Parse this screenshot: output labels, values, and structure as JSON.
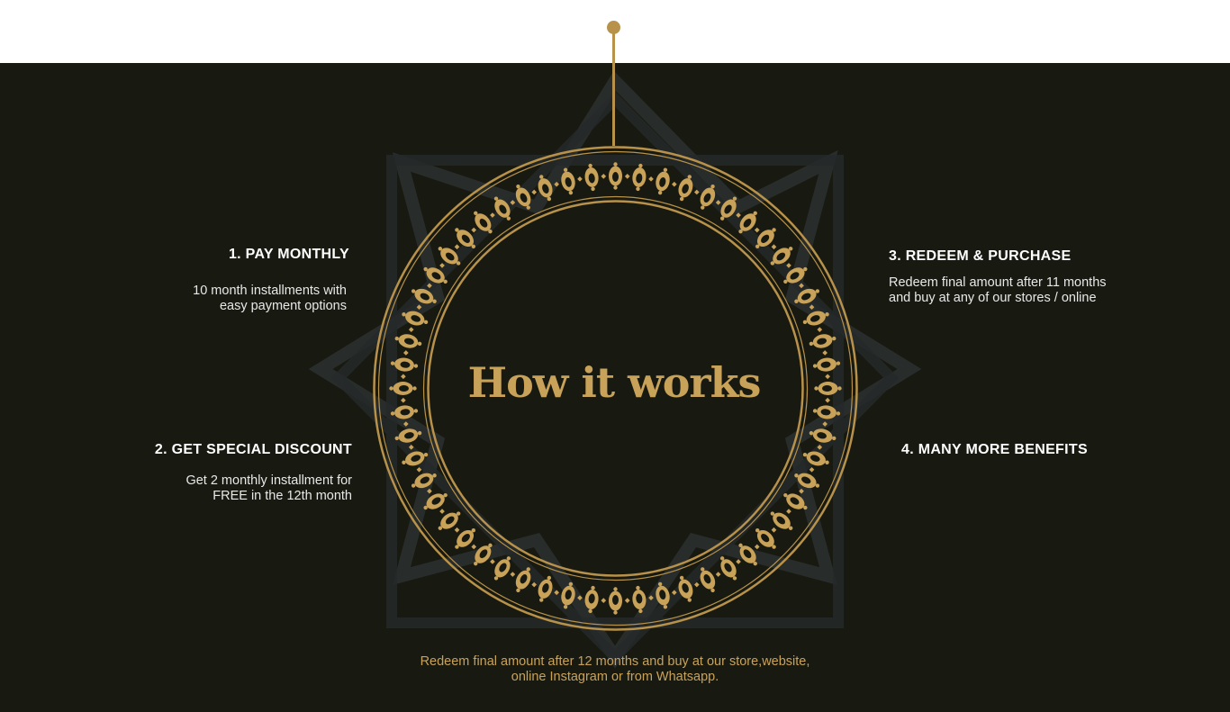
{
  "title": "How it works",
  "colors": {
    "gold": "#c9a25a",
    "dark_bg": "#181a11",
    "text": "#ffffff"
  },
  "steps": [
    {
      "title": "1. PAY MONTHLY",
      "desc_lines": [
        "10 month installments with",
        "easy payment options"
      ]
    },
    {
      "title": "2. GET SPECIAL DISCOUNT",
      "desc_lines": [
        "Get 2 monthly installment for",
        "FREE in the 12th month"
      ]
    },
    {
      "title": "3. REDEEM & PURCHASE",
      "desc_lines": [
        "Redeem final amount after 11 months",
        "and buy at any of our stores / online"
      ]
    },
    {
      "title": "4. MANY MORE BENEFITS",
      "desc_lines": []
    }
  ],
  "footer_lines": [
    "Redeem final amount after 12 months and buy at our store,website,",
    "online Instagram or from Whatsapp."
  ]
}
